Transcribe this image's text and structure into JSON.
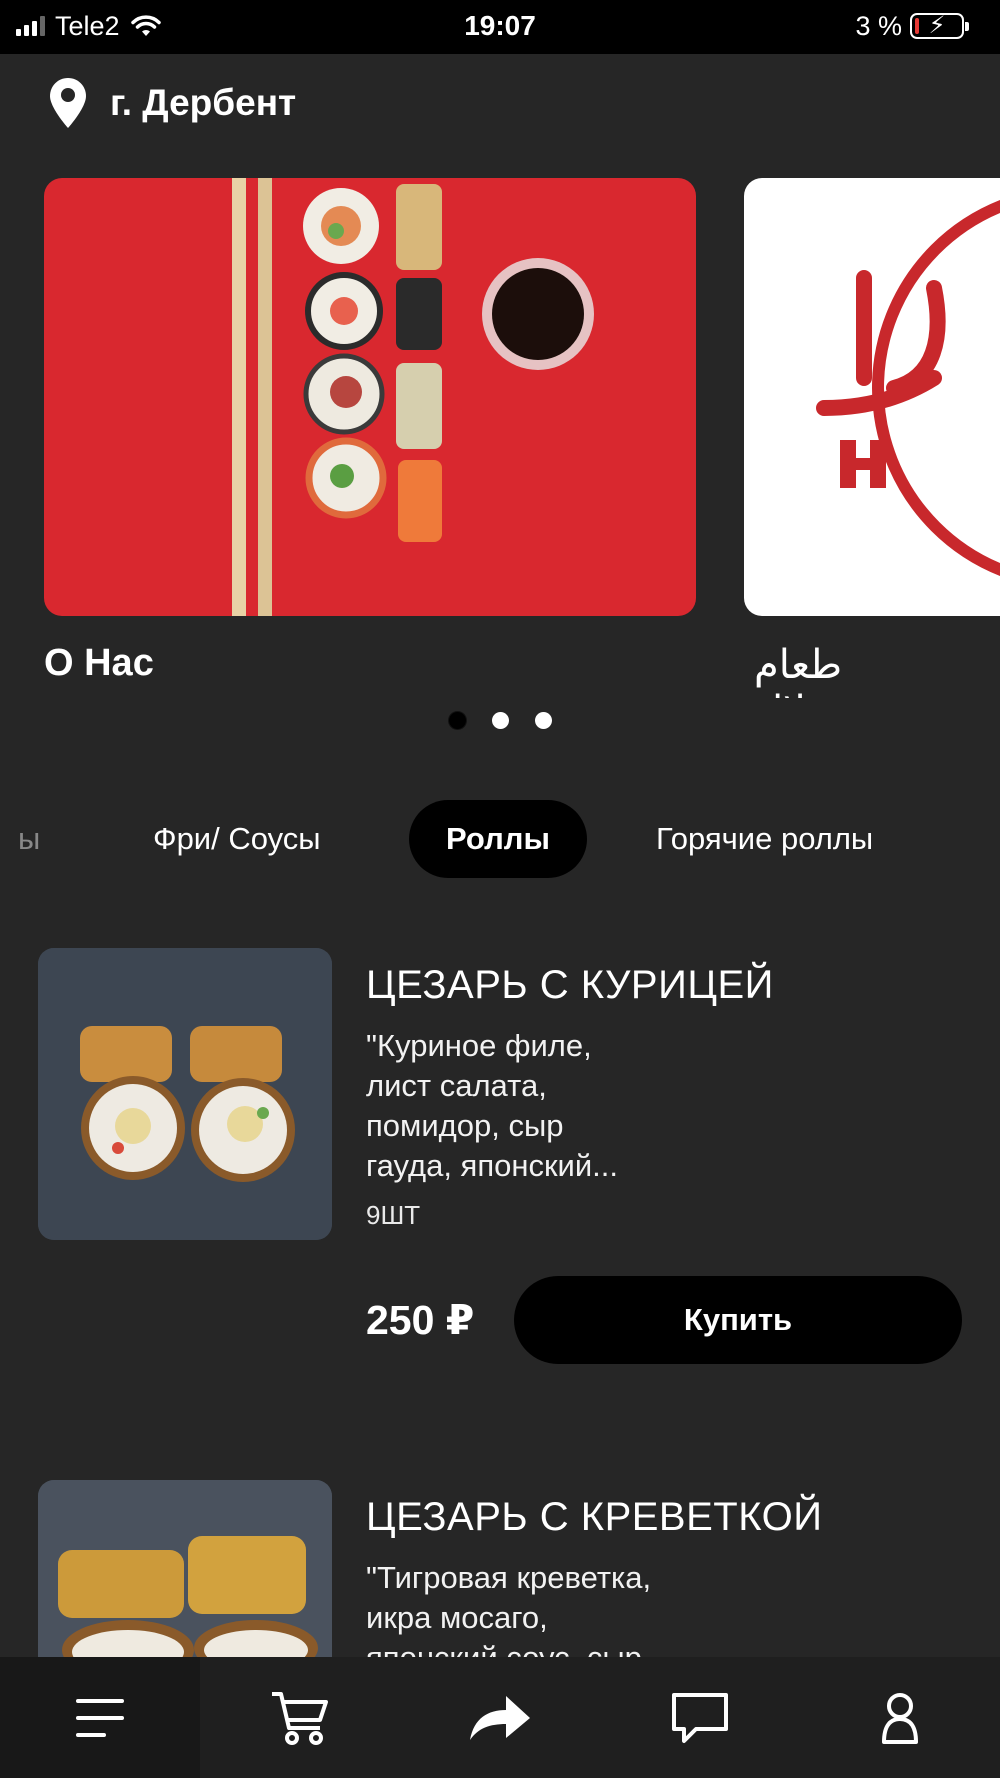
{
  "status_bar": {
    "carrier": "Tele2",
    "time": "19:07",
    "battery_percent": "3 %",
    "battery_level": 0.03
  },
  "location": {
    "city": "г. Дербент"
  },
  "carousel": {
    "slides": [
      {
        "caption": "О Нас"
      },
      {
        "caption": "طعام حلال"
      }
    ],
    "active_index": 0,
    "total": 3
  },
  "categories": {
    "items": [
      {
        "label": "ы"
      },
      {
        "label": "Фри/ Соусы"
      },
      {
        "label": "Роллы"
      },
      {
        "label": "Горячие роллы"
      }
    ],
    "active_index": 2
  },
  "products": [
    {
      "name": "ЦЕЗАРЬ С КУРИЦЕЙ",
      "desc_lines": [
        "\"Куриное филе,",
        "лист салата,",
        "помидор, сыр",
        "гауда, японский..."
      ],
      "qty": "9ШТ",
      "price": "250 ₽",
      "buy_label": "Купить"
    },
    {
      "name": "ЦЕЗАРЬ С КРЕВЕТКОЙ",
      "desc_lines": [
        "\"Тигровая креветка,",
        "икра мосаго,",
        "японский соус, сыр"
      ]
    }
  ],
  "bottom_nav": {
    "items": [
      {
        "icon": "menu-icon"
      },
      {
        "icon": "cart-icon"
      },
      {
        "icon": "share-icon"
      },
      {
        "icon": "chat-icon"
      },
      {
        "icon": "profile-icon"
      }
    ],
    "active_index": 0
  },
  "colors": {
    "background": "#262626",
    "banner_red": "#d9282f",
    "halal_red": "#c8282c",
    "button_black": "#000000"
  }
}
